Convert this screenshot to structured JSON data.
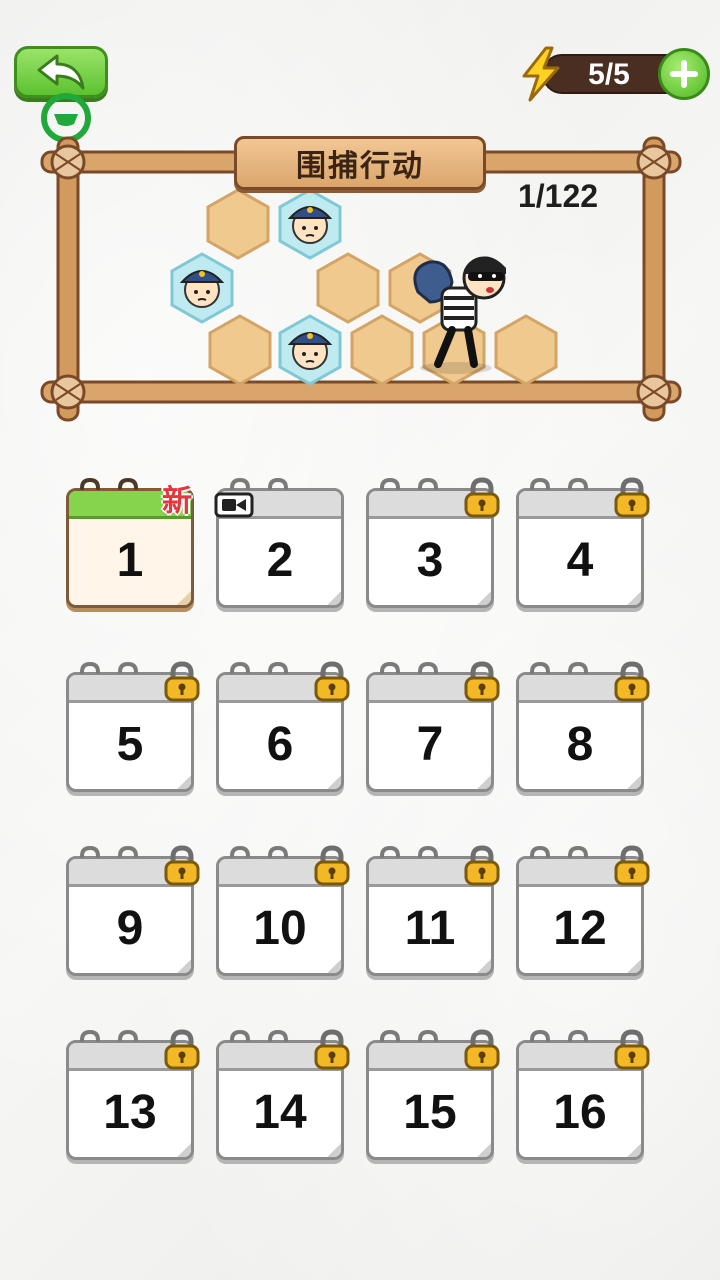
{
  "header": {
    "back_icon": "back-arrow-icon",
    "ad_icon": "ad-marker-icon",
    "energy": {
      "count": "5/5",
      "icon": "lightning-bolt-icon",
      "add_icon": "plus-icon"
    }
  },
  "preview": {
    "title": "围捕行动",
    "progress": "1/122"
  },
  "levels": [
    {
      "number": "1",
      "state": "current",
      "badge": "新"
    },
    {
      "number": "2",
      "state": "video",
      "icon": "video-camera-icon"
    },
    {
      "number": "3",
      "state": "locked"
    },
    {
      "number": "4",
      "state": "locked"
    },
    {
      "number": "5",
      "state": "locked"
    },
    {
      "number": "6",
      "state": "locked"
    },
    {
      "number": "7",
      "state": "locked"
    },
    {
      "number": "8",
      "state": "locked"
    },
    {
      "number": "9",
      "state": "locked"
    },
    {
      "number": "10",
      "state": "locked"
    },
    {
      "number": "11",
      "state": "locked"
    },
    {
      "number": "12",
      "state": "locked"
    },
    {
      "number": "13",
      "state": "locked"
    },
    {
      "number": "14",
      "state": "locked"
    },
    {
      "number": "15",
      "state": "locked"
    },
    {
      "number": "16",
      "state": "locked"
    }
  ],
  "colors": {
    "accent_green": "#5cc22f",
    "wood": "#c98b52",
    "lock": "#f2b826",
    "new_badge": "#e8343c"
  }
}
